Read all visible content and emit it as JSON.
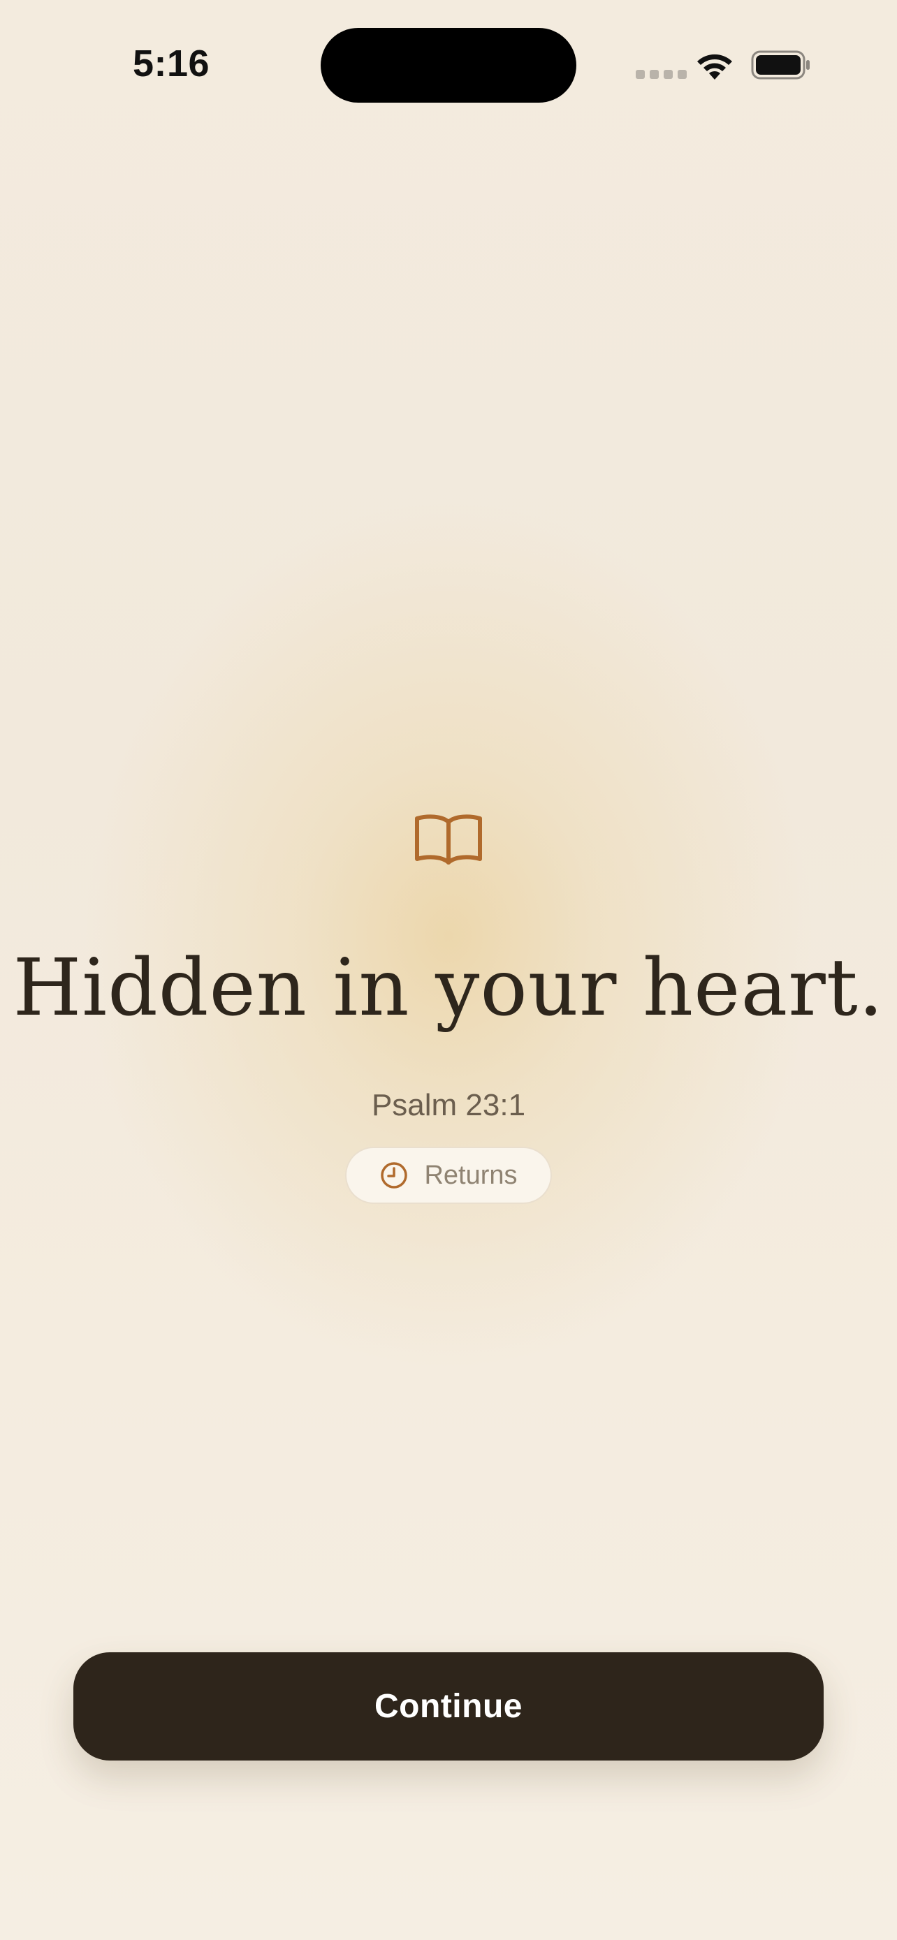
{
  "status_bar": {
    "time": "5:16"
  },
  "main": {
    "icon": "open-book-icon",
    "headline": "Hidden in your heart.",
    "reference": "Psalm 23:1",
    "pill": {
      "icon": "clock-icon",
      "label": "Returns"
    }
  },
  "actions": {
    "continue_label": "Continue"
  },
  "colors": {
    "background": "#f4ece0",
    "glow": "#ecd6aa",
    "accent_icon": "#b06a2c",
    "headline_text": "#2e261c",
    "button_bg": "#2e251b",
    "button_text": "#ffffff"
  }
}
